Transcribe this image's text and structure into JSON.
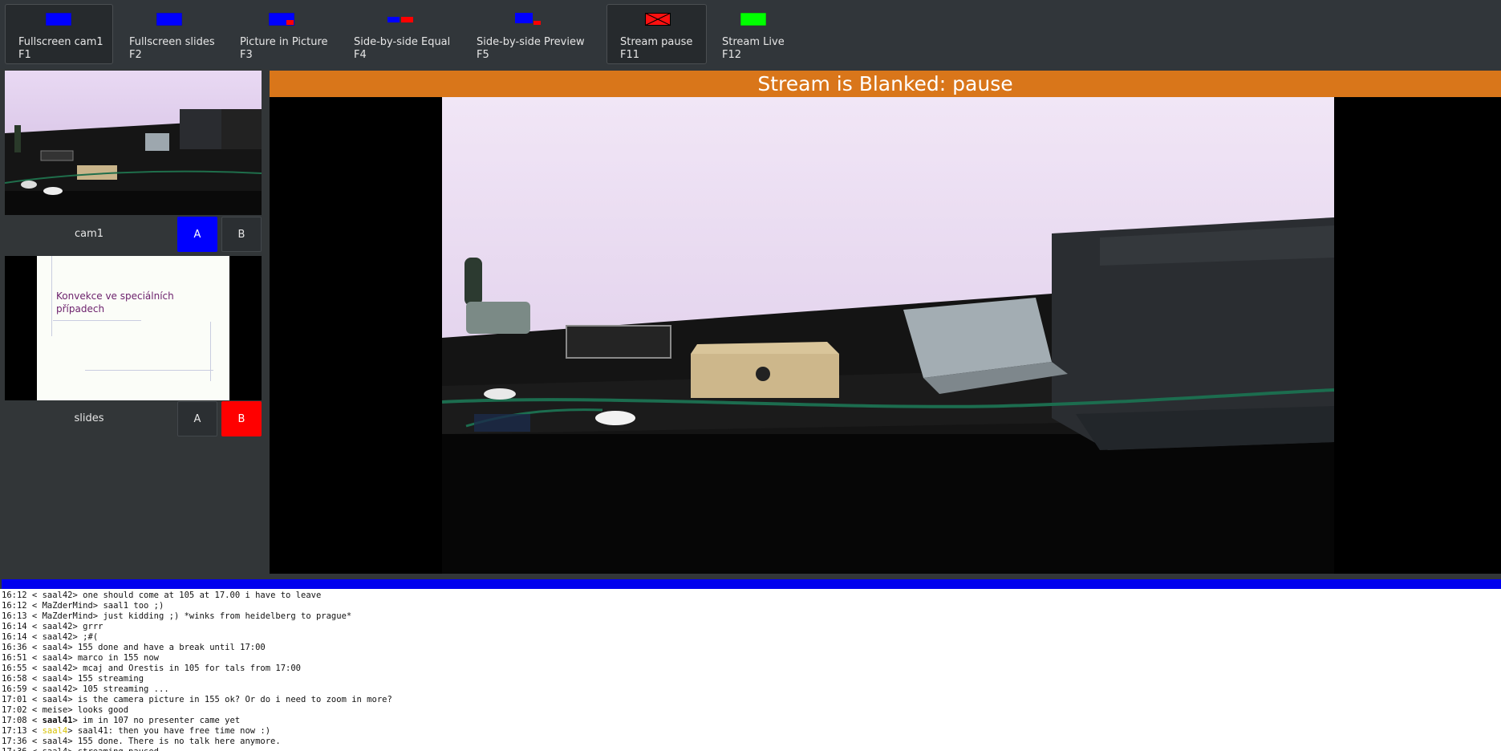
{
  "toolbar": {
    "buttons": [
      {
        "label": "Fullscreen cam1",
        "key": "F1",
        "icon": "fullscreen-cam-icon",
        "active": true
      },
      {
        "label": "Fullscreen slides",
        "key": "F2",
        "icon": "fullscreen-slides-icon",
        "active": false
      },
      {
        "label": "Picture in Picture",
        "key": "F3",
        "icon": "picture-in-picture-icon",
        "active": false
      },
      {
        "label": "Side-by-side Equal",
        "key": "F4",
        "icon": "side-by-side-equal-icon",
        "active": false
      },
      {
        "label": "Side-by-side Preview",
        "key": "F5",
        "icon": "side-by-side-preview-icon",
        "active": false
      },
      {
        "label": "Stream pause",
        "key": "F11",
        "icon": "stream-pause-icon",
        "active": true
      },
      {
        "label": "Stream Live",
        "key": "F12",
        "icon": "stream-live-icon",
        "active": false
      }
    ]
  },
  "sources": [
    {
      "name": "cam1",
      "a_label": "A",
      "b_label": "B",
      "selected": "A"
    },
    {
      "name": "slides",
      "a_label": "A",
      "b_label": "B",
      "selected": "B"
    }
  ],
  "slide_preview": {
    "title_line1": "Konvekce ve speciálních",
    "title_line2": "případech"
  },
  "main": {
    "banner": "Stream is Blanked: pause"
  },
  "chat": {
    "lines": [
      {
        "time": "16:12",
        "nick": "saal42",
        "msg": "one should come at 105 at 17.00 i have to leave"
      },
      {
        "time": "16:12",
        "nick": "MaZderMind",
        "msg": "saal1 too ;)"
      },
      {
        "time": "16:13",
        "nick": "MaZderMind",
        "msg": "just kidding ;) *winks from heidelberg to prague*"
      },
      {
        "time": "16:14",
        "nick": "saal42",
        "msg": "grrr"
      },
      {
        "time": "16:14",
        "nick": "saal42",
        "msg": ";#("
      },
      {
        "time": "16:36",
        "nick": "saal4",
        "msg": "155 done and have a break until 17:00"
      },
      {
        "time": "16:51",
        "nick": "saal4",
        "msg": "marco in 155 now"
      },
      {
        "time": "16:55",
        "nick": "saal42",
        "msg": "mcaj and Orestis in 105 for tals from 17:00"
      },
      {
        "time": "16:58",
        "nick": "saal4",
        "msg": "155 streaming"
      },
      {
        "time": "16:59",
        "nick": "saal42",
        "msg": "105 streaming ..."
      },
      {
        "time": "17:01",
        "nick": "saal4",
        "msg": "is the camera picture in 155 ok? Or do i need to zoom in more?"
      },
      {
        "time": "17:02",
        "nick": "meise",
        "msg": "looks good"
      },
      {
        "time": "17:08",
        "nick": "saal41",
        "msg": "im in 107 no presenter came yet",
        "style": "bold"
      },
      {
        "time": "17:13",
        "nick": "saal4",
        "msg": "saal41: then you have free time now :)",
        "style": "hl"
      },
      {
        "time": "17:36",
        "nick": "saal4",
        "msg": "155 done. There is no talk here anymore."
      },
      {
        "time": "17:36",
        "nick": "saal4",
        "msg": "streaming paused"
      }
    ]
  },
  "colors": {
    "banner": "#d9761a",
    "select_a": "#0000ff",
    "select_b": "#ff0000",
    "chat_bar": "#0000ee"
  }
}
